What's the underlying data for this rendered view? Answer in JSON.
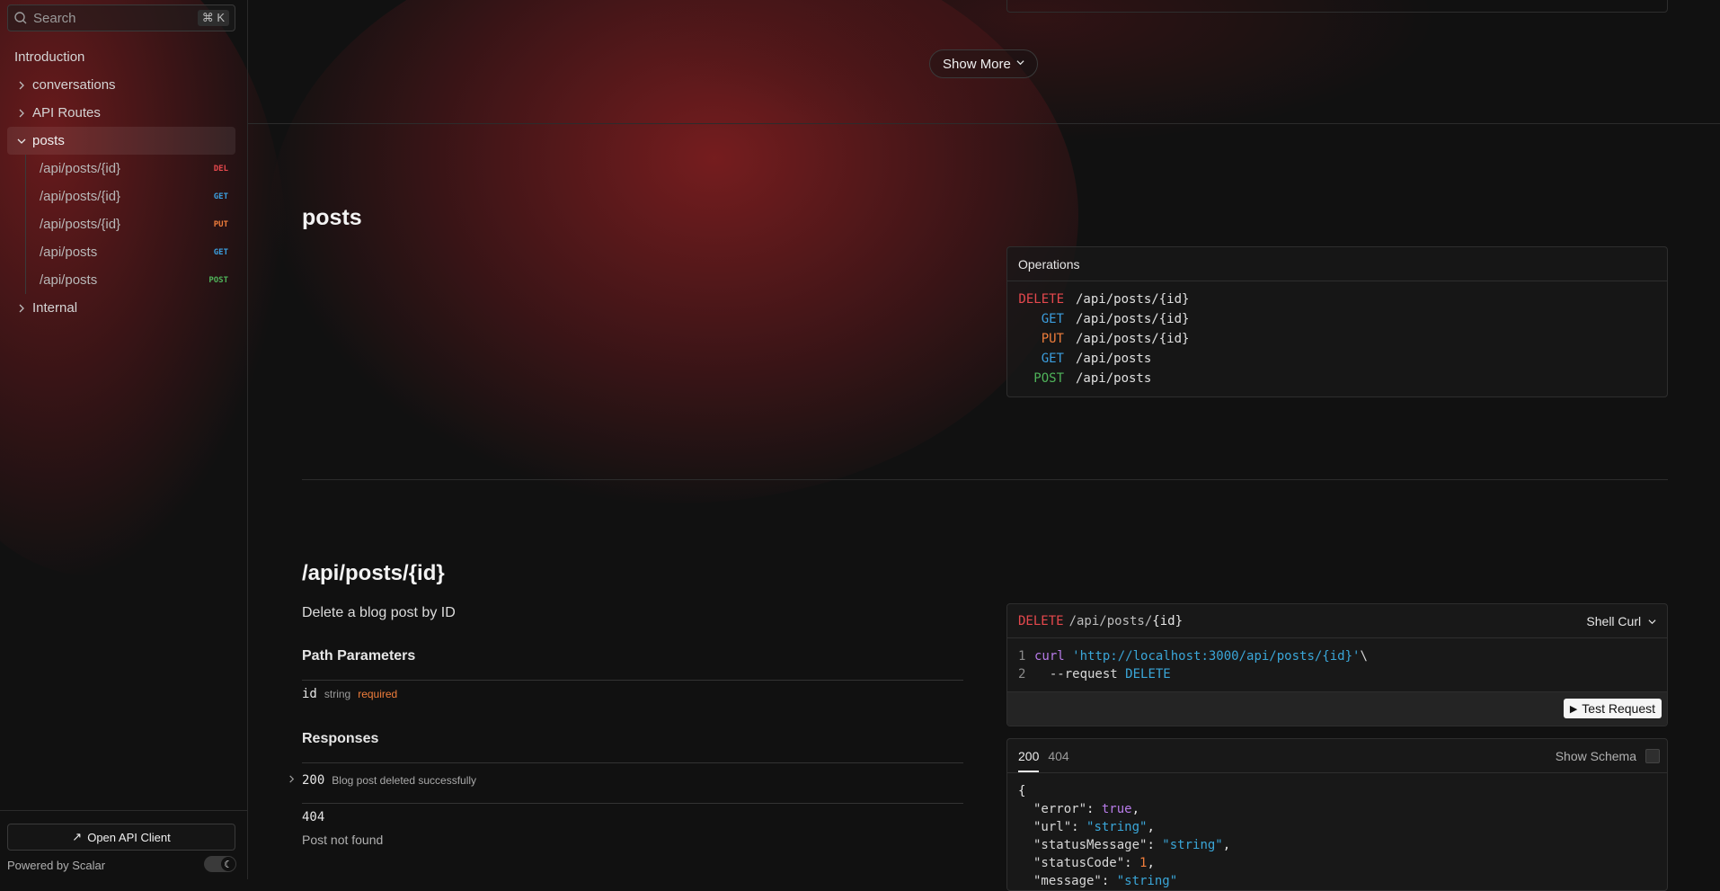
{
  "search": {
    "placeholder": "Search",
    "shortcut": "⌘ K"
  },
  "sidebar": {
    "introduction": "Introduction",
    "groups": [
      {
        "label": "conversations"
      },
      {
        "label": "API Routes"
      },
      {
        "label": "posts"
      },
      {
        "label": "Internal"
      }
    ],
    "posts_items": [
      {
        "path": "/api/posts/{id}",
        "method": "DEL"
      },
      {
        "path": "/api/posts/{id}",
        "method": "GET"
      },
      {
        "path": "/api/posts/{id}",
        "method": "PUT"
      },
      {
        "path": "/api/posts",
        "method": "GET"
      },
      {
        "path": "/api/posts",
        "method": "POST"
      }
    ],
    "open_client": "Open API Client",
    "powered_by": "Powered by Scalar"
  },
  "main": {
    "show_more": "Show More",
    "section_title": "posts",
    "operations": {
      "title": "Operations",
      "rows": [
        {
          "method": "DELETE",
          "path": "/api/posts/{id}"
        },
        {
          "method": "GET",
          "path": "/api/posts/{id}"
        },
        {
          "method": "PUT",
          "path": "/api/posts/{id}"
        },
        {
          "method": "GET",
          "path": "/api/posts"
        },
        {
          "method": "POST",
          "path": "/api/posts"
        }
      ]
    },
    "endpoint": {
      "title": "/api/posts/{id}",
      "description": "Delete a blog post by ID",
      "path_params_title": "Path Parameters",
      "param": {
        "name": "id",
        "type": "string",
        "required": "required"
      },
      "responses_title": "Responses",
      "responses": [
        {
          "code": "200",
          "description": "Blog post deleted successfully"
        },
        {
          "code": "404",
          "description": "Post not found"
        }
      ]
    },
    "request": {
      "method": "DELETE",
      "path_prefix": "/api/posts/",
      "path_param": "{id}",
      "language": "Shell Curl",
      "line1": {
        "num": "1",
        "cmd": "curl",
        "url": "'http://localhost:3000/api/posts/{id}'",
        "cont": " \\"
      },
      "line2": {
        "num": "2",
        "flag": "  --request",
        "value": "DELETE"
      },
      "test_button": "Test Request"
    },
    "response_example": {
      "tabs": [
        "200",
        "404"
      ],
      "show_schema": "Show Schema",
      "open_brace": "{",
      "fields": [
        {
          "key": "\"error\"",
          "value": "true",
          "kind": "bool"
        },
        {
          "key": "\"url\"",
          "value": "\"string\"",
          "kind": "str"
        },
        {
          "key": "\"statusMessage\"",
          "value": "\"string\"",
          "kind": "str"
        },
        {
          "key": "\"statusCode\"",
          "value": "1",
          "kind": "num"
        },
        {
          "key": "\"message\"",
          "value": "\"string\"",
          "kind": "str"
        }
      ]
    }
  },
  "colors": {
    "delete": "#e5484d",
    "get": "#3b9ede",
    "put": "#ef7d3b",
    "post": "#4fb35a",
    "accent_glow": "#7c1e20"
  }
}
